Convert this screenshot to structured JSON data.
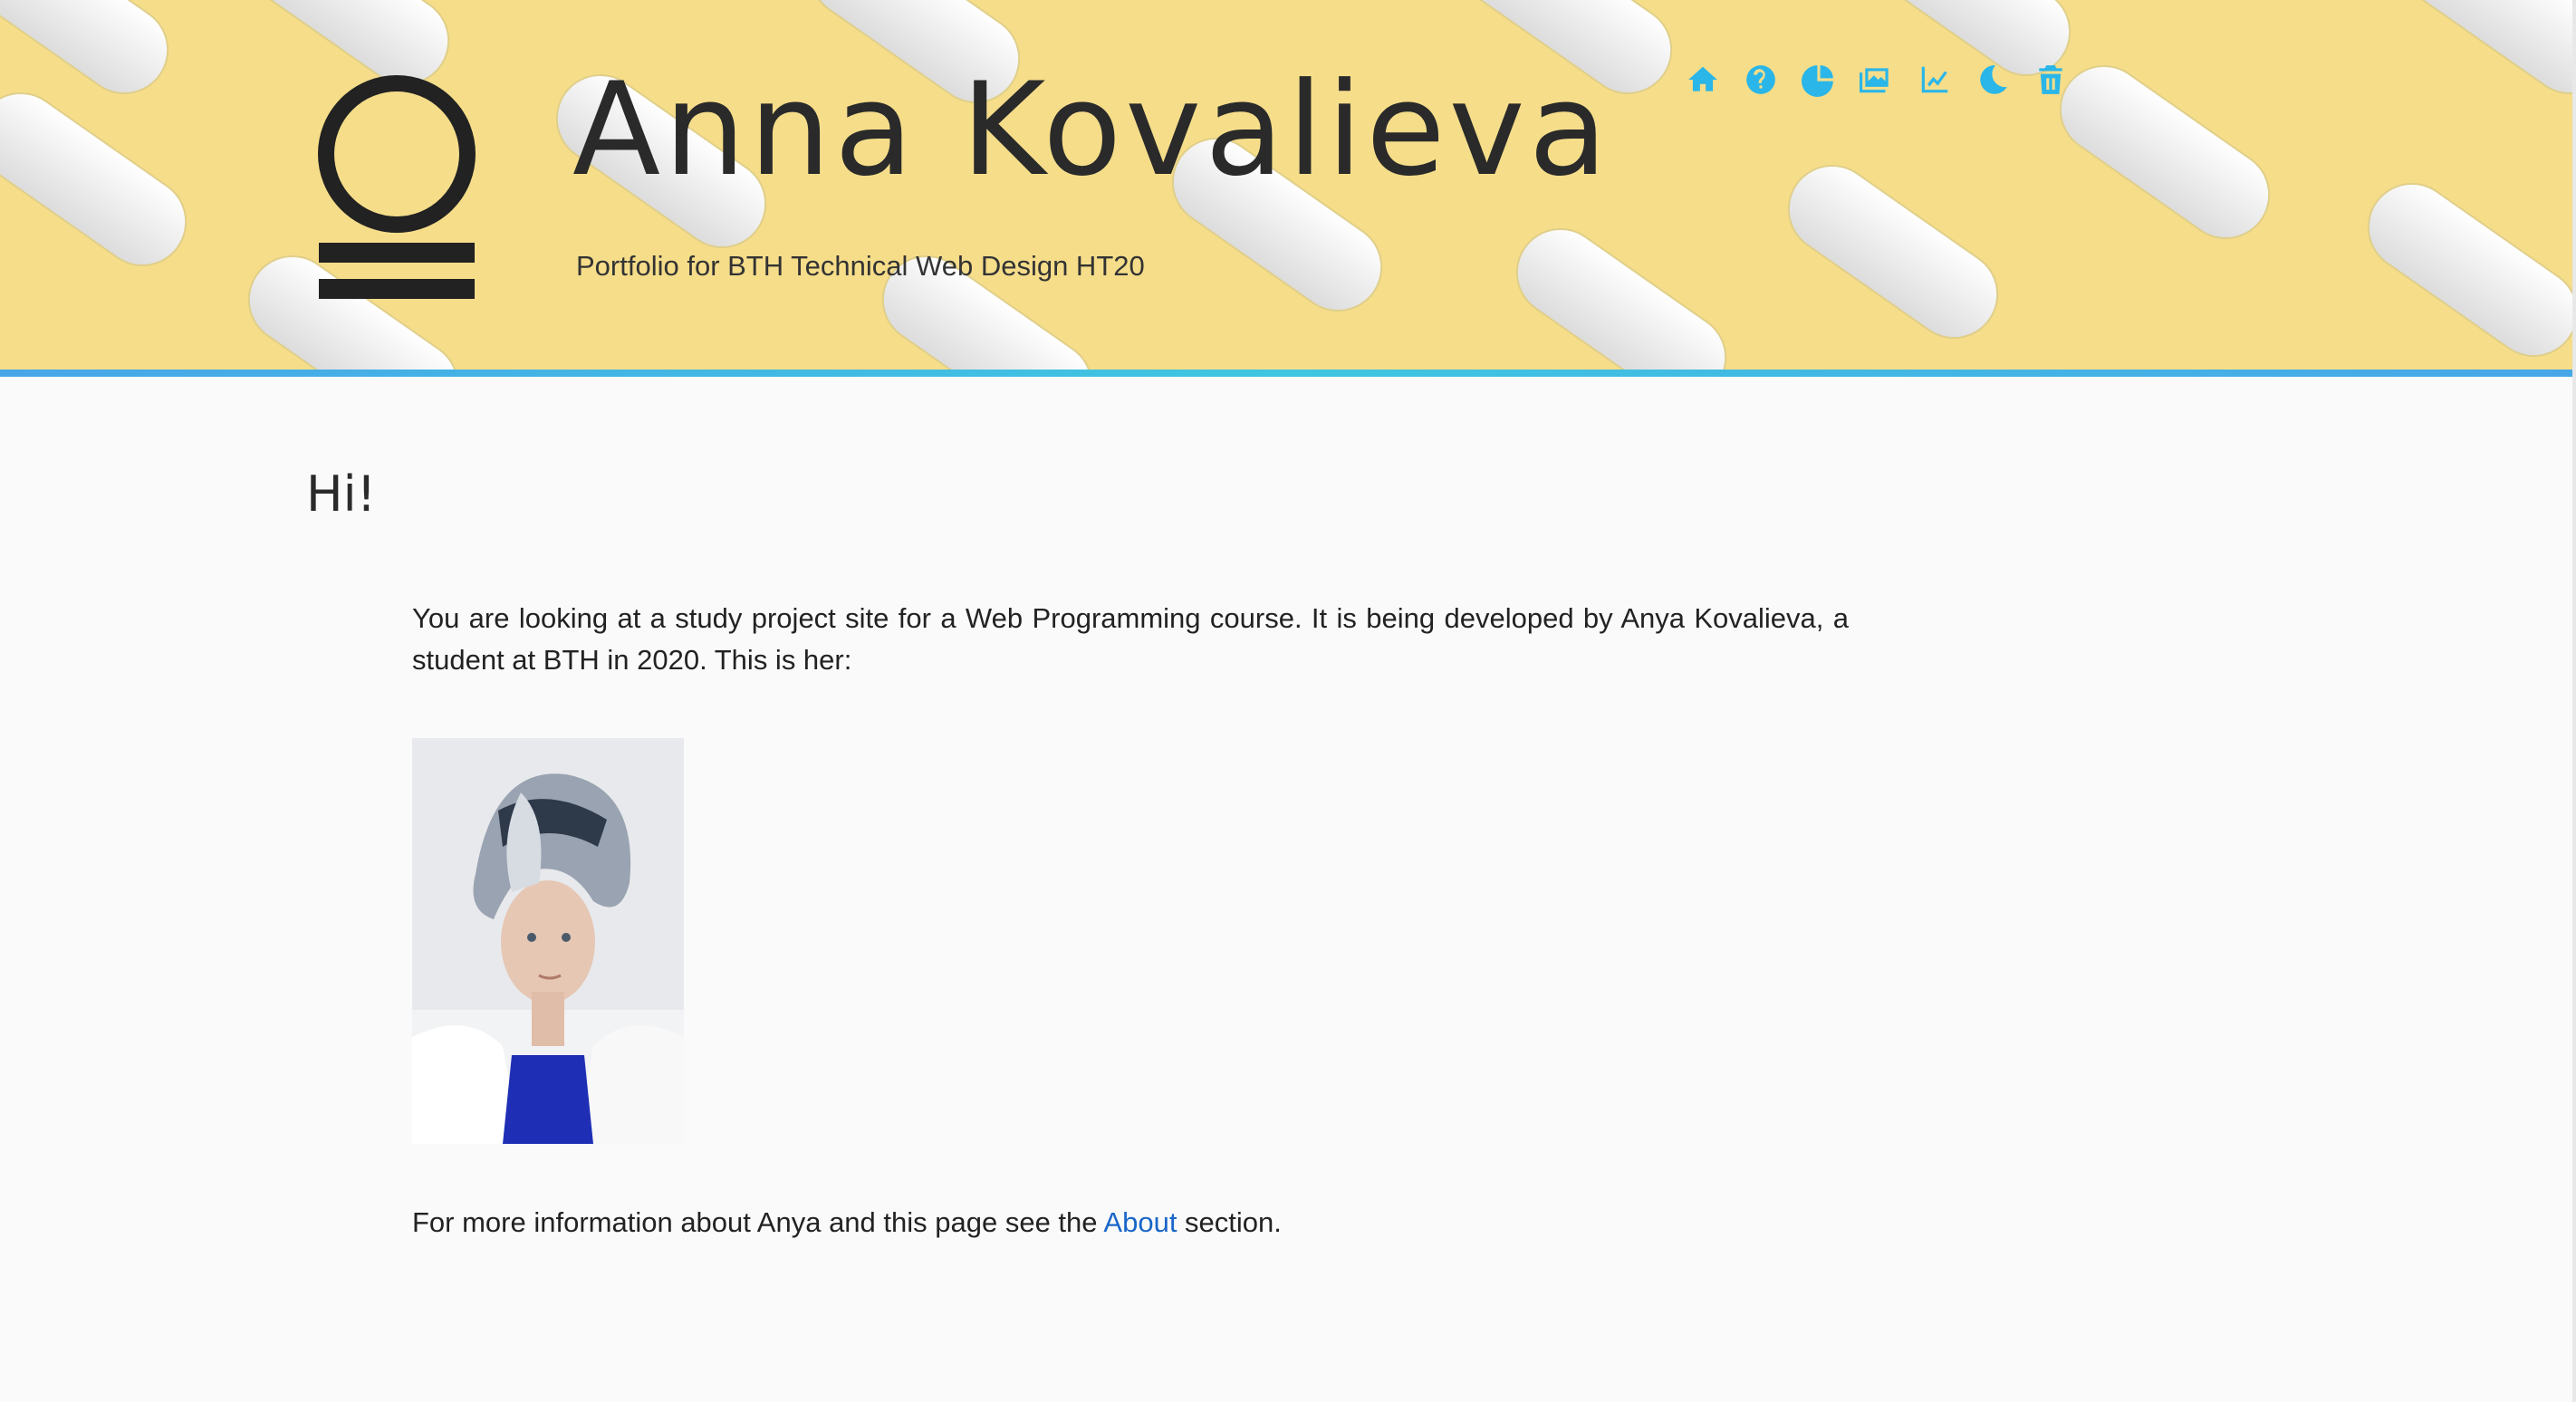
{
  "header": {
    "title": "Anna Kovalieva",
    "subtitle": "Portfolio for BTH Technical Web Design HT20",
    "background_color": "#f5dd8a",
    "accent_color": "#2ab6e8"
  },
  "nav": [
    {
      "icon": "home-icon"
    },
    {
      "icon": "question-circle-icon"
    },
    {
      "icon": "pie-chart-icon"
    },
    {
      "icon": "images-icon"
    },
    {
      "icon": "chart-line-icon"
    },
    {
      "icon": "moon-icon"
    },
    {
      "icon": "trash-icon"
    }
  ],
  "main": {
    "heading": "Hi!",
    "intro": "You are looking at a study project site for a Web Programming course. It is being developed by Anya Kovalieva, a student at BTH in 2020. This is her:",
    "more_prefix": "For more information about Anya and this page see the ",
    "more_link": "About",
    "more_suffix": " section."
  }
}
